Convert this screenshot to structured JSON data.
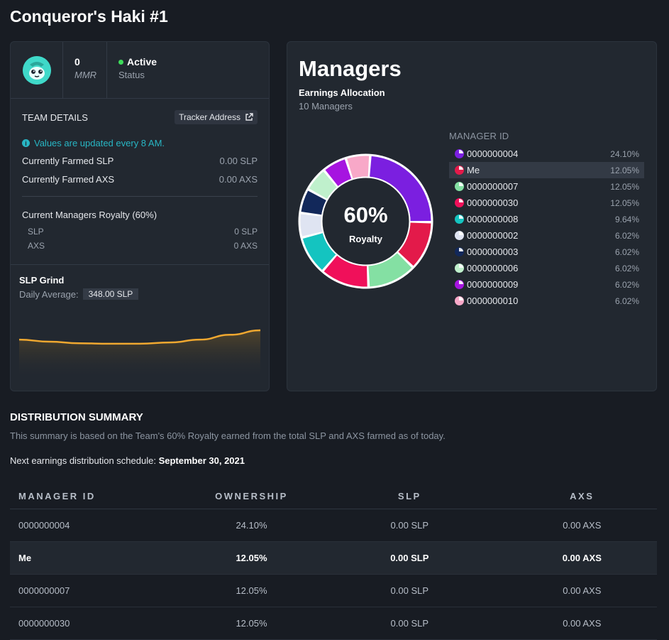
{
  "page": {
    "title": "Conqueror's Haki #1"
  },
  "team": {
    "mmr_value": "0",
    "mmr_label": "MMR",
    "status_value": "Active",
    "status_label": "Status",
    "details_title": "TEAM DETAILS",
    "tracker_label": "Tracker Address",
    "info_note": "Values are updated every 8 AM.",
    "farmed_slp_label": "Currently Farmed SLP",
    "farmed_slp_value": "0.00 SLP",
    "farmed_axs_label": "Currently Farmed AXS",
    "farmed_axs_value": "0.00 AXS",
    "royalty_title": "Current Managers Royalty (60%)",
    "royalty_slp_label": "SLP",
    "royalty_slp_value": "0 SLP",
    "royalty_axs_label": "AXS",
    "royalty_axs_value": "0 AXS"
  },
  "grind": {
    "title": "SLP Grind",
    "daily_label": "Daily Average:",
    "daily_value": "348.00 SLP",
    "line_values": [
      340,
      335,
      331,
      330,
      330,
      333,
      340,
      352,
      363
    ]
  },
  "managers": {
    "title": "Managers",
    "allocation_title": "Earnings Allocation",
    "count_label": "10 Managers",
    "center_value": "60%",
    "center_label": "Royalty",
    "legend_header": "MANAGER ID",
    "rows": [
      {
        "id": "0000000004",
        "pct": "24.10%",
        "share": 24.1,
        "color": "#7b1fe0"
      },
      {
        "id": "Me",
        "pct": "12.05%",
        "share": 12.05,
        "color": "#e31a4a",
        "selected": true
      },
      {
        "id": "0000000007",
        "pct": "12.05%",
        "share": 12.05,
        "color": "#84e0a3"
      },
      {
        "id": "0000000030",
        "pct": "12.05%",
        "share": 12.05,
        "color": "#f0105a"
      },
      {
        "id": "0000000008",
        "pct": "9.64%",
        "share": 9.64,
        "color": "#14c4c0"
      },
      {
        "id": "0000000002",
        "pct": "6.02%",
        "share": 6.02,
        "color": "#dfe4f2"
      },
      {
        "id": "0000000003",
        "pct": "6.02%",
        "share": 6.02,
        "color": "#12285a"
      },
      {
        "id": "0000000006",
        "pct": "6.02%",
        "share": 6.02,
        "color": "#bff0cc"
      },
      {
        "id": "0000000009",
        "pct": "6.02%",
        "share": 6.02,
        "color": "#a614e0"
      },
      {
        "id": "0000000010",
        "pct": "6.02%",
        "share": 6.02,
        "color": "#f8a8c8"
      }
    ]
  },
  "distribution": {
    "title": "DISTRIBUTION SUMMARY",
    "description": "This summary is based on the Team's 60% Royalty earned from the total SLP and AXS farmed as of today.",
    "schedule_label": "Next earnings distribution schedule:",
    "schedule_date": "September 30, 2021",
    "columns": [
      "MANAGER ID",
      "OWNERSHIP",
      "SLP",
      "AXS"
    ],
    "rows": [
      {
        "id": "0000000004",
        "ownership": "24.10%",
        "slp": "0.00 SLP",
        "axs": "0.00 AXS"
      },
      {
        "id": "Me",
        "ownership": "12.05%",
        "slp": "0.00 SLP",
        "axs": "0.00 AXS"
      },
      {
        "id": "0000000007",
        "ownership": "12.05%",
        "slp": "0.00 SLP",
        "axs": "0.00 AXS"
      },
      {
        "id": "0000000030",
        "ownership": "12.05%",
        "slp": "0.00 SLP",
        "axs": "0.00 AXS"
      }
    ]
  }
}
